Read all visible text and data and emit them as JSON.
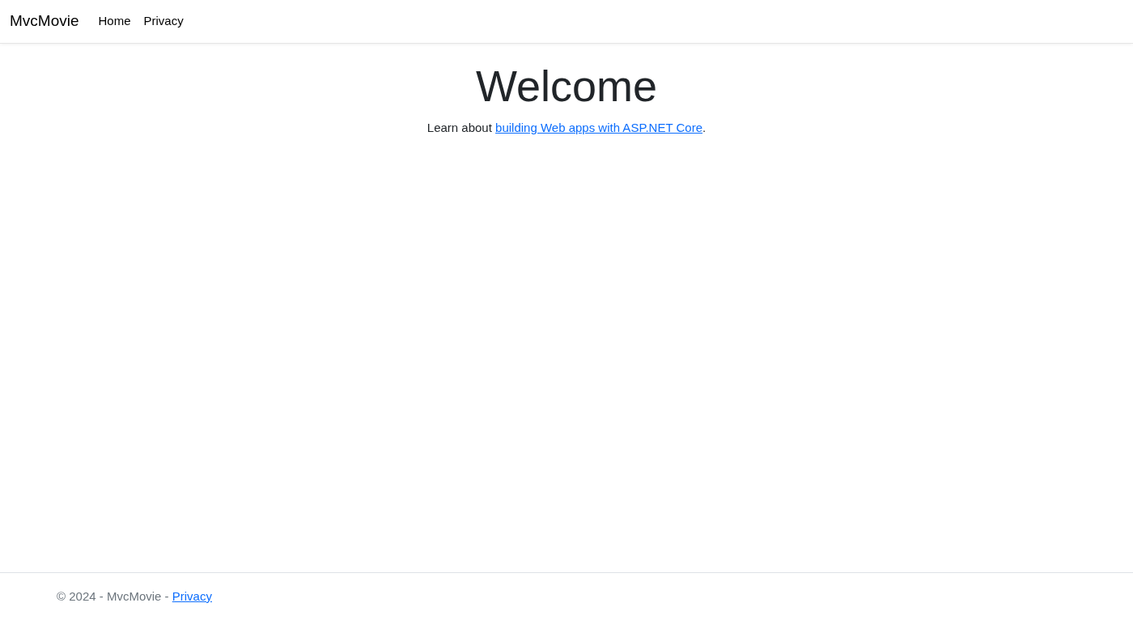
{
  "navbar": {
    "brand": "MvcMovie",
    "links": [
      "Home",
      "Privacy"
    ]
  },
  "main": {
    "heading": "Welcome",
    "intro": {
      "before": "Learn about ",
      "link": "building Web apps with ASP.NET Core",
      "after": "."
    }
  },
  "footer": {
    "text": "© 2024 - MvcMovie - ",
    "link": "Privacy"
  }
}
